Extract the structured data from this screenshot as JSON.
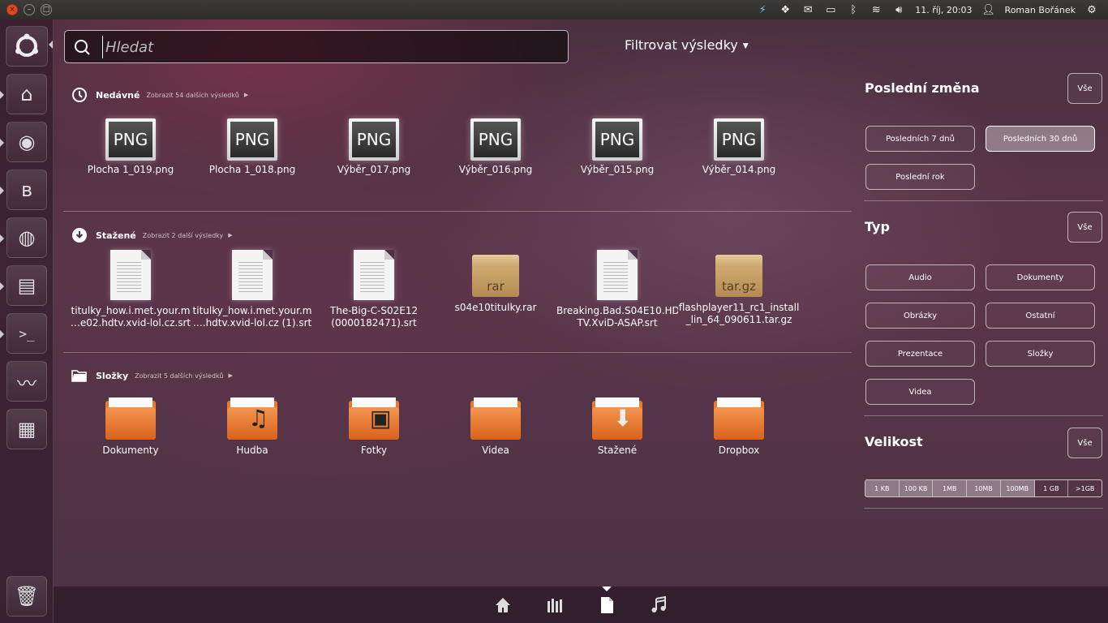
{
  "panel": {
    "date_time": "11. říj, 20:03",
    "user": "Roman Bořánek"
  },
  "search": {
    "placeholder": "Hledat"
  },
  "filter_toggle": "Filtrovat výsledky",
  "recent": {
    "title": "Nedávné",
    "more": "Zobrazit 54 dalších výsledků",
    "items": [
      "Plocha 1_019.png",
      "Plocha 1_018.png",
      "Výběr_017.png",
      "Výběr_016.png",
      "Výběr_015.png",
      "Výběr_014.png"
    ],
    "icon_label": "PNG"
  },
  "downloads": {
    "title": "Stažené",
    "more": "Zobrazit 2 další výsledky",
    "items": [
      {
        "line1": "titulky_how.i.met.your.m",
        "line2": "…e02.hdtv.xvid-lol.cz.srt",
        "kind": "doc"
      },
      {
        "line1": "titulky_how.i.met.your.m",
        "line2": "….hdtv.xvid-lol.cz (1).srt",
        "kind": "doc"
      },
      {
        "line1": "The-Big-C-S02E12",
        "line2": "(0000182471).srt",
        "kind": "doc"
      },
      {
        "line1": "s04e10titulky.rar",
        "line2": "",
        "kind": "box",
        "box_label": "rar"
      },
      {
        "line1": "Breaking.Bad.S04E10.HD",
        "line2": "TV.XviD-ASAP.srt",
        "kind": "doc"
      },
      {
        "line1": "flashplayer11_rc1_install",
        "line2": "_lin_64_090611.tar.gz",
        "kind": "box",
        "box_label": "tar.gz"
      }
    ]
  },
  "folders": {
    "title": "Složky",
    "more": "Zobrazit 5 dalších výsledků",
    "items": [
      "Dokumenty",
      "Hudba",
      "Fotky",
      "Videa",
      "Stažené",
      "Dropbox"
    ]
  },
  "filters": {
    "last_change": {
      "title": "Poslední změna",
      "all": "Vše",
      "options": [
        "Posledních 7 dnů",
        "Posledních 30 dnů",
        "Poslední rok"
      ],
      "selected": "Posledních 30 dnů"
    },
    "type": {
      "title": "Typ",
      "all": "Vše",
      "options": [
        "Audio",
        "Dokumenty",
        "Obrázky",
        "Ostatní",
        "Prezentace",
        "Složky",
        "Videa"
      ]
    },
    "size": {
      "title": "Velikost",
      "all": "Vše",
      "options": [
        "1 KB",
        "100 KB",
        "1MB",
        "10MB",
        "100MB",
        "1 GB",
        ">1GB"
      ],
      "selected_range": [
        0,
        4
      ]
    }
  },
  "lenses": [
    "home-lens",
    "applications-lens",
    "files-lens",
    "music-lens"
  ],
  "active_lens": "files-lens",
  "colors": {
    "accent_orange": "#e77a2c",
    "panel_bg": "#3c3b37",
    "close_btn": "#df4a16"
  }
}
